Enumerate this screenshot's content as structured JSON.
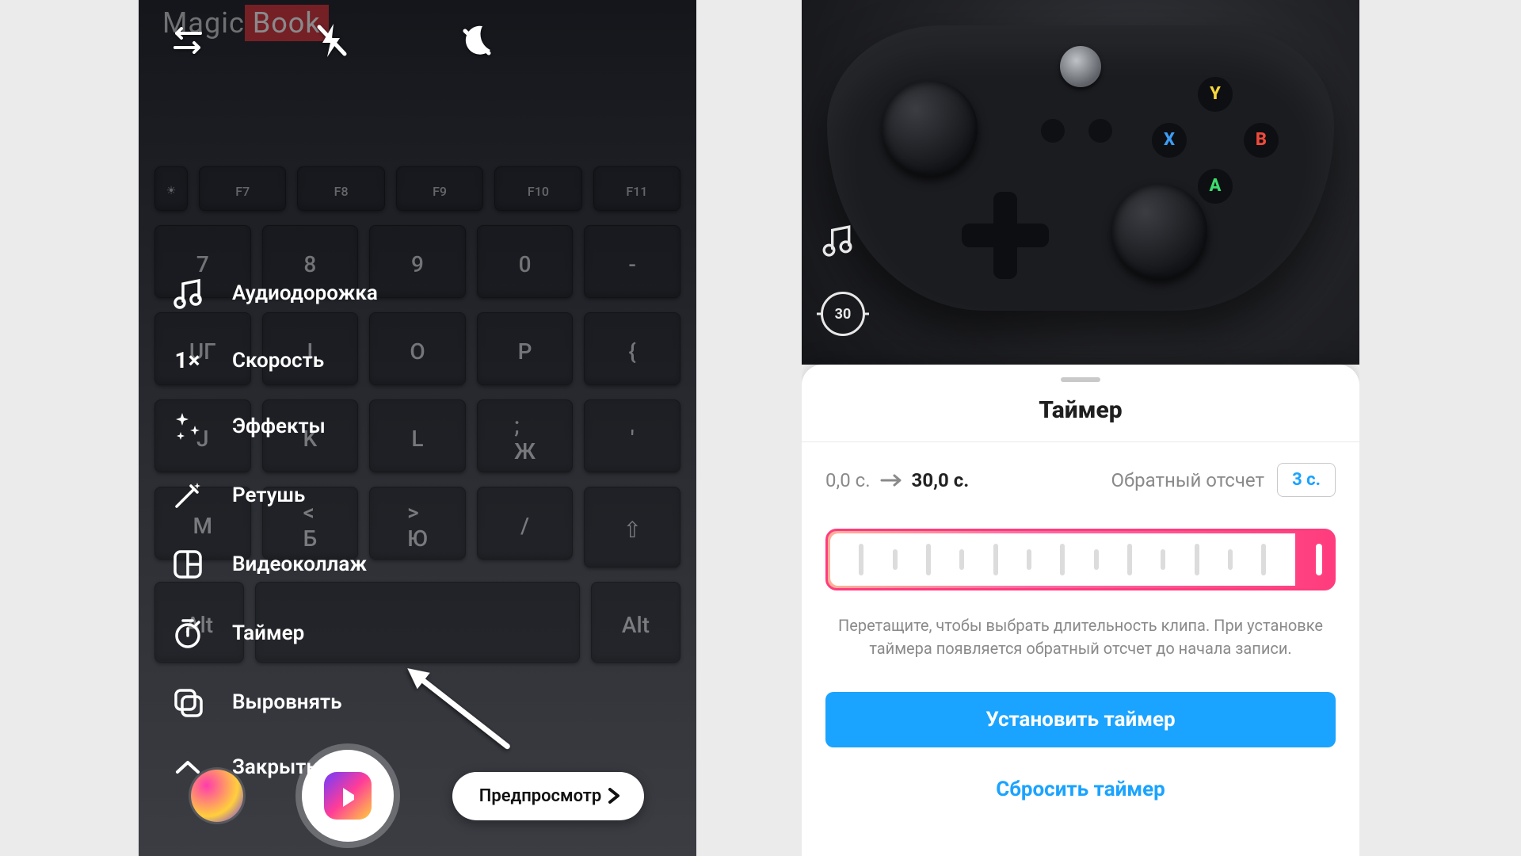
{
  "left": {
    "brand_plain": "Magic",
    "brand_accent": "Book",
    "tools": {
      "audio": "Аудиодорожка",
      "speed": "Скорость",
      "speed_val": "1×",
      "effects": "Эффекты",
      "retouch": "Ретушь",
      "collage": "Видеоколлаж",
      "timer": "Таймер",
      "align": "Выровнять",
      "close": "Закрыть"
    },
    "preview_button": "Предпросмотр"
  },
  "right": {
    "duration_badge": "30",
    "sheet": {
      "title": "Таймер",
      "range_from": "0,0 с.",
      "range_to": "30,0 с.",
      "countdown_label": "Обратный отсчет",
      "countdown_value": "3 с.",
      "help": "Перетащите, чтобы выбрать длительность клипа. При установке таймера появляется обратный отсчет до начала записи.",
      "set": "Установить таймер",
      "reset": "Сбросить таймер"
    }
  }
}
